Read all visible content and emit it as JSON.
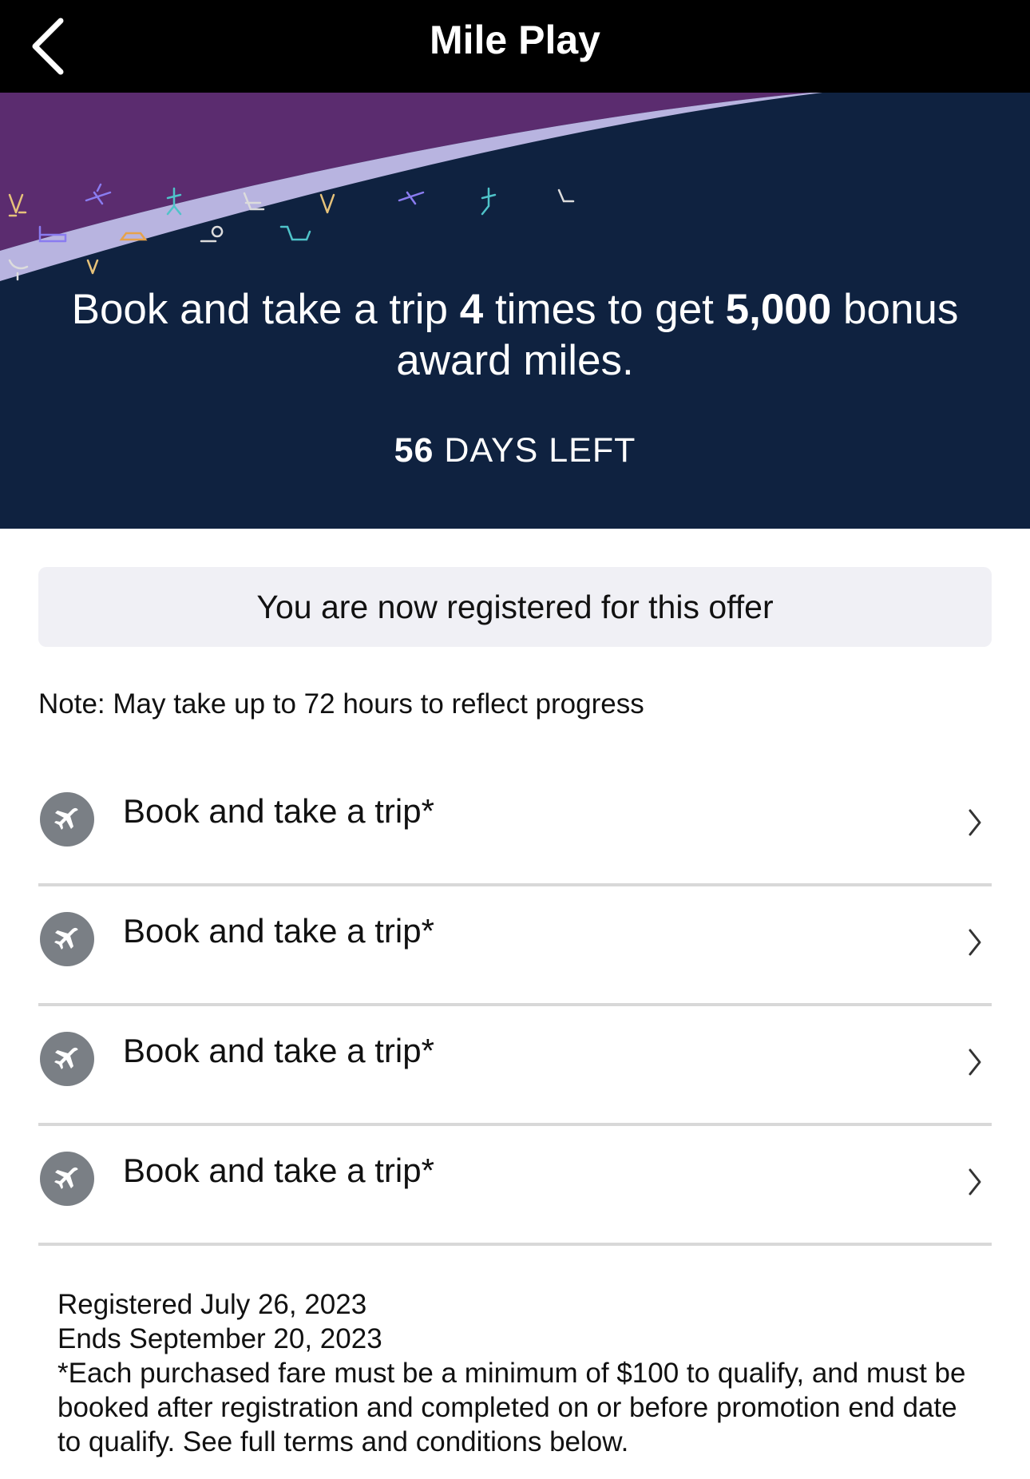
{
  "header": {
    "title": "Mile Play",
    "back_icon": "chevron-left-icon"
  },
  "hero": {
    "headline_pre": "Book and take a trip ",
    "headline_count": "4",
    "headline_mid": " times to get ",
    "headline_bonus": "5,000",
    "headline_post": " bonus award miles.",
    "days_number": "56",
    "days_label": " DAYS LEFT",
    "colors": {
      "background": "#0f2240",
      "purple": "#5b2c6f",
      "lavender": "#b8b4e0"
    }
  },
  "registration": {
    "banner": "You are now registered for this offer",
    "note": "Note: May take up to 72 hours to reflect progress"
  },
  "trips": [
    {
      "label": "Book and take a trip*",
      "icon": "airplane-icon"
    },
    {
      "label": "Book and take a trip*",
      "icon": "airplane-icon"
    },
    {
      "label": "Book and take a trip*",
      "icon": "airplane-icon"
    },
    {
      "label": "Book and take a trip*",
      "icon": "airplane-icon"
    }
  ],
  "footer": {
    "registered": "Registered July 26, 2023",
    "ends": "Ends September 20, 2023",
    "terms": "*Each purchased fare must be a minimum of $100 to qualify, and must be booked after registration and completed on or before promotion end date to qualify. See full terms and conditions below."
  }
}
